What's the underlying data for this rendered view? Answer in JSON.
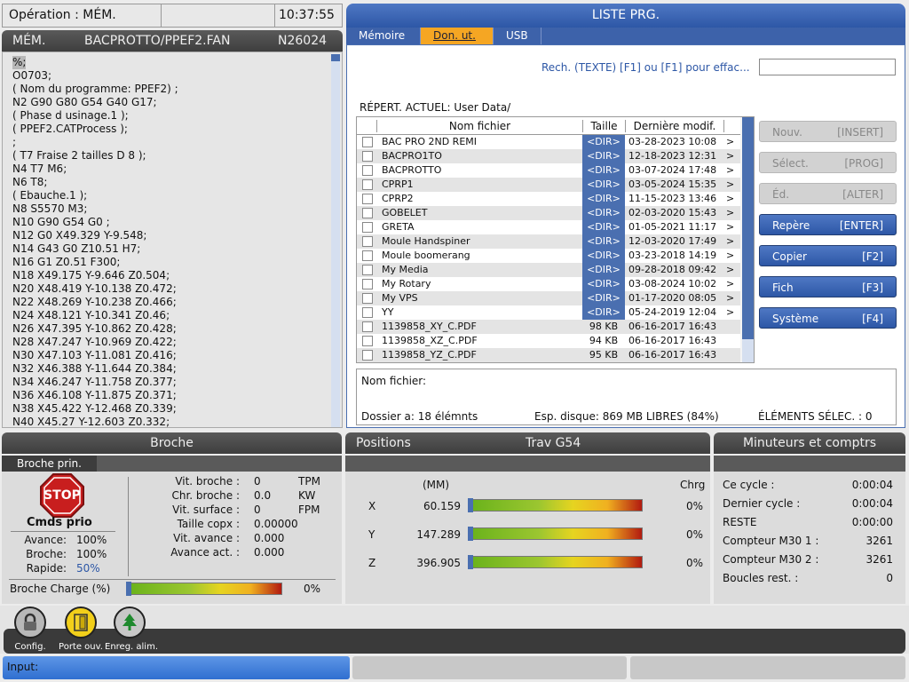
{
  "status": {
    "operation": "Opération : MÉM.",
    "clock": "10:37:55"
  },
  "program": {
    "mode": "MÉM.",
    "path": "BACPROTTO/PPEF2.FAN",
    "number": "N26024",
    "lines": [
      "%;",
      "O0703;",
      "( Nom du programme: PPEF2) ;",
      "N2 G90 G80 G54 G40 G17;",
      "( Phase d usinage.1 );",
      "( PPEF2.CATProcess );",
      ";",
      "( T7 Fraise 2 tailles D 8 );",
      "N4 T7 M6;",
      "N6 T8;",
      "( Ebauche.1 );",
      "N8 S5570 M3;",
      "N10 G90 G54 G0 ;",
      "N12 G0 X49.329 Y-9.548;",
      "N14 G43 G0 Z10.51 H7;",
      "N16 G1 Z0.51 F300;",
      "N18 X49.175 Y-9.646 Z0.504;",
      "N20 X48.419 Y-10.138 Z0.472;",
      "N22 X48.269 Y-10.238 Z0.466;",
      "N24 X48.121 Y-10.341 Z0.46;",
      "N26 X47.395 Y-10.862 Z0.428;",
      "N28 X47.247 Y-10.969 Z0.422;",
      "N30 X47.103 Y-11.081 Z0.416;",
      "N32 X46.388 Y-11.644 Z0.384;",
      "N34 X46.247 Y-11.758 Z0.377;",
      "N36 X46.108 Y-11.875 Z0.371;",
      "N38 X45.422 Y-12.468 Z0.339;",
      "N40 X45.27 Y-12.603 Z0.332;"
    ]
  },
  "list": {
    "title": "LISTE PRG.",
    "tabs": [
      "Mémoire",
      "Don. ut.",
      "USB"
    ],
    "search_label": "Rech. (TEXTE) [F1] ou [F1] pour effac...",
    "search_value": "",
    "current_dir": "RÉPERT. ACTUEL: User Data/",
    "columns": [
      "Nom fichier",
      "Taille",
      "Dernière modif."
    ],
    "files": [
      {
        "name": "BAC PRO 2ND REMI",
        "size": "<DIR>",
        "date": "03-28-2023 10:08",
        "arrow": ">"
      },
      {
        "name": "BACPRO1TO",
        "size": "<DIR>",
        "date": "12-18-2023 12:31",
        "arrow": ">"
      },
      {
        "name": "BACPROTTO",
        "size": "<DIR>",
        "date": "03-07-2024 17:48",
        "arrow": ">"
      },
      {
        "name": "CPRP1",
        "size": "<DIR>",
        "date": "03-05-2024 15:35",
        "arrow": ">"
      },
      {
        "name": "CPRP2",
        "size": "<DIR>",
        "date": "11-15-2023 13:46",
        "arrow": ">"
      },
      {
        "name": "GOBELET",
        "size": "<DIR>",
        "date": "02-03-2020 15:43",
        "arrow": ">"
      },
      {
        "name": "GRETA",
        "size": "<DIR>",
        "date": "01-05-2021 11:17",
        "arrow": ">"
      },
      {
        "name": "Moule Handspiner",
        "size": "<DIR>",
        "date": "12-03-2020 17:49",
        "arrow": ">"
      },
      {
        "name": "Moule boomerang",
        "size": "<DIR>",
        "date": "03-23-2018 14:19",
        "arrow": ">"
      },
      {
        "name": "My Media",
        "size": "<DIR>",
        "date": "09-28-2018 09:42",
        "arrow": ">"
      },
      {
        "name": "My Rotary",
        "size": "<DIR>",
        "date": "03-08-2024 10:02",
        "arrow": ">"
      },
      {
        "name": "My VPS",
        "size": "<DIR>",
        "date": "01-17-2020 08:05",
        "arrow": ">"
      },
      {
        "name": "YY",
        "size": "<DIR>",
        "date": "05-24-2019 12:04",
        "arrow": ">"
      },
      {
        "name": "1139858_XY_C.PDF",
        "size": "98 KB",
        "date": "06-16-2017 16:43",
        "arrow": ""
      },
      {
        "name": "1139858_XZ_C.PDF",
        "size": "94 KB",
        "date": "06-16-2017 16:43",
        "arrow": ""
      },
      {
        "name": "1139858_YZ_C.PDF",
        "size": "95 KB",
        "date": "06-16-2017 16:43",
        "arrow": ""
      }
    ],
    "filename_label": "Nom fichier:",
    "folder_count": "Dossier a: 18 élémnts",
    "disk_space": "Esp. disque: 869 MB LIBRES (84%)",
    "selected": "ÉLÉMENTS SÉLEC. : 0",
    "buttons": [
      {
        "label": "Nouv.",
        "key": "[INSERT]",
        "enabled": false
      },
      {
        "label": "Sélect.",
        "key": "[PROG]",
        "enabled": false
      },
      {
        "label": "Éd.",
        "key": "[ALTER]",
        "enabled": false
      },
      {
        "label": "Repère",
        "key": "[ENTER]",
        "enabled": true
      },
      {
        "label": "Copier",
        "key": "[F2]",
        "enabled": true
      },
      {
        "label": "Fich",
        "key": "[F3]",
        "enabled": true
      },
      {
        "label": "Système",
        "key": "[F4]",
        "enabled": true
      }
    ]
  },
  "spindle": {
    "title": "Broche",
    "tab": "Broche prin.",
    "stop_text": "STOP",
    "cmds_label": "Cmds prio",
    "overrides": [
      {
        "label": "Avance:",
        "value": "100%"
      },
      {
        "label": "Broche:",
        "value": "100%"
      },
      {
        "label": "Rapide:",
        "value": "50%"
      }
    ],
    "stats": [
      {
        "label": "Vit. broche :",
        "value": "0",
        "unit": "TPM"
      },
      {
        "label": "Chr. broche :",
        "value": "0.0",
        "unit": "KW"
      },
      {
        "label": "Vit. surface :",
        "value": "0",
        "unit": "FPM"
      },
      {
        "label": "Taille copx :",
        "value": "0.00000",
        "unit": ""
      },
      {
        "label": "Vit. avance :",
        "value": "0.000",
        "unit": ""
      },
      {
        "label": "Avance act. :",
        "value": "0.000",
        "unit": ""
      }
    ],
    "load_label": "Broche Charge (%)",
    "load_value": "0%",
    "load_fraction": 0
  },
  "positions": {
    "title": "Positions",
    "frame": "Trav G54",
    "unit_label": "(MM)",
    "load_label": "Chrg",
    "axes": [
      {
        "axis": "X",
        "value": "60.159",
        "load": "0%"
      },
      {
        "axis": "Y",
        "value": "147.289",
        "load": "0%"
      },
      {
        "axis": "Z",
        "value": "396.905",
        "load": "0%"
      }
    ]
  },
  "timers": {
    "title": "Minuteurs et comptrs",
    "rows": [
      {
        "label": "Ce cycle :",
        "value": "0:00:04"
      },
      {
        "label": "Dernier cycle :",
        "value": "0:00:04"
      },
      {
        "label": "RESTE",
        "value": "0:00:00"
      },
      {
        "label": "Compteur M30 1 :",
        "value": "3261"
      },
      {
        "label": "Compteur M30 2 :",
        "value": "3261"
      },
      {
        "label": "Boucles rest. :",
        "value": "0"
      }
    ]
  },
  "icons": [
    {
      "label": "Config.",
      "icon": "lock-icon"
    },
    {
      "label": "Porte ouv.",
      "icon": "door-icon"
    },
    {
      "label": "Enreg. alim.",
      "icon": "tree-icon"
    }
  ],
  "input": {
    "label": "Input:"
  },
  "colors": {
    "accent": "#2d57a6",
    "tab_active": "#f5a623",
    "stop": "#d42020"
  }
}
